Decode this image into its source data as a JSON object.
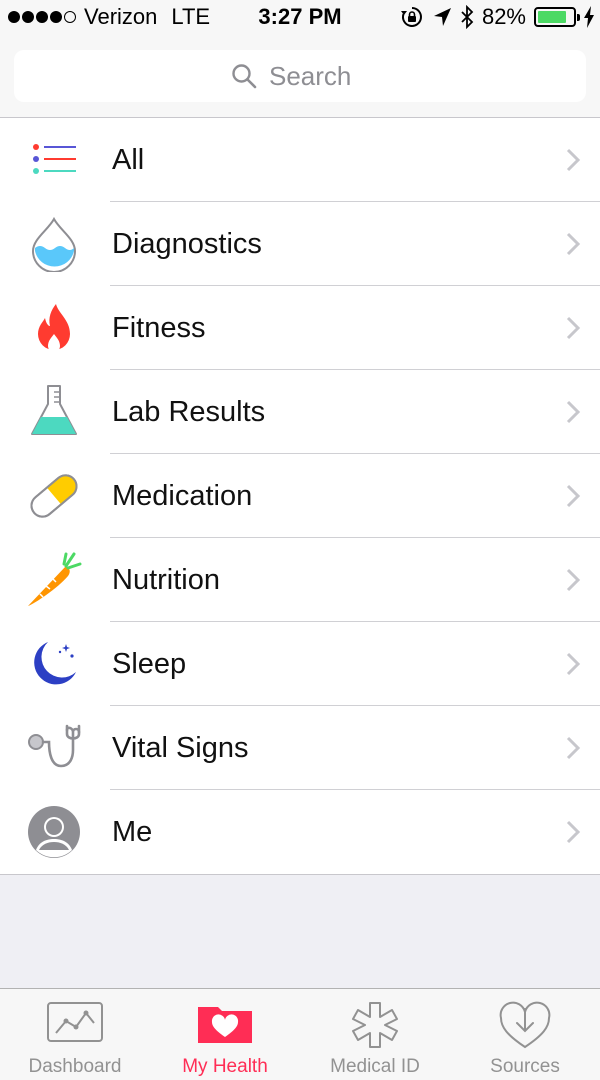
{
  "status_bar": {
    "carrier": "Verizon",
    "network": "LTE",
    "time": "3:27 PM",
    "battery": "82%",
    "battery_level": 0.82,
    "signal_bars": 4
  },
  "search": {
    "placeholder": "Search"
  },
  "categories": [
    {
      "label": "All",
      "icon": "list-icon"
    },
    {
      "label": "Diagnostics",
      "icon": "water-drop-icon"
    },
    {
      "label": "Fitness",
      "icon": "flame-icon"
    },
    {
      "label": "Lab Results",
      "icon": "flask-icon"
    },
    {
      "label": "Medication",
      "icon": "pill-icon"
    },
    {
      "label": "Nutrition",
      "icon": "carrot-icon"
    },
    {
      "label": "Sleep",
      "icon": "moon-icon"
    },
    {
      "label": "Vital Signs",
      "icon": "stethoscope-icon"
    },
    {
      "label": "Me",
      "icon": "person-icon"
    }
  ],
  "tab_bar": {
    "tabs": [
      {
        "label": "Dashboard",
        "icon": "chart-icon",
        "active": false
      },
      {
        "label": "My Health",
        "icon": "heart-folder-icon",
        "active": true
      },
      {
        "label": "Medical ID",
        "icon": "asterisk-icon",
        "active": false
      },
      {
        "label": "Sources",
        "icon": "download-heart-icon",
        "active": false
      }
    ]
  },
  "colors": {
    "accent": "#ff2d55",
    "battery": "#4cd964",
    "background": "#efeff4"
  }
}
